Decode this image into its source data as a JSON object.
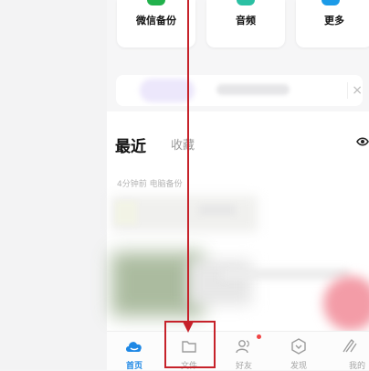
{
  "shortcuts": [
    {
      "label": "微信备份",
      "icon": "wechat-backup-icon",
      "color": "#22b14c"
    },
    {
      "label": "音频",
      "icon": "audio-icon",
      "color": "#2bc0a3"
    },
    {
      "label": "更多",
      "icon": "more-icon",
      "color": "#1c9be8"
    }
  ],
  "banner": {
    "close_glyph": "×"
  },
  "recent": {
    "tabs": [
      "最近",
      "收藏"
    ],
    "meta": "4分钟前  电脑备份"
  },
  "tabbar": {
    "items": [
      {
        "label": "首页",
        "icon": "home-cloud-icon",
        "active": true
      },
      {
        "label": "文件",
        "icon": "folder-icon",
        "active": false
      },
      {
        "label": "好友",
        "icon": "friends-icon",
        "active": false,
        "badge": true
      },
      {
        "label": "发现",
        "icon": "discover-icon",
        "active": false
      },
      {
        "label": "我的",
        "icon": "profile-icon",
        "active": false
      }
    ]
  },
  "annotation_color": "#c6222a"
}
